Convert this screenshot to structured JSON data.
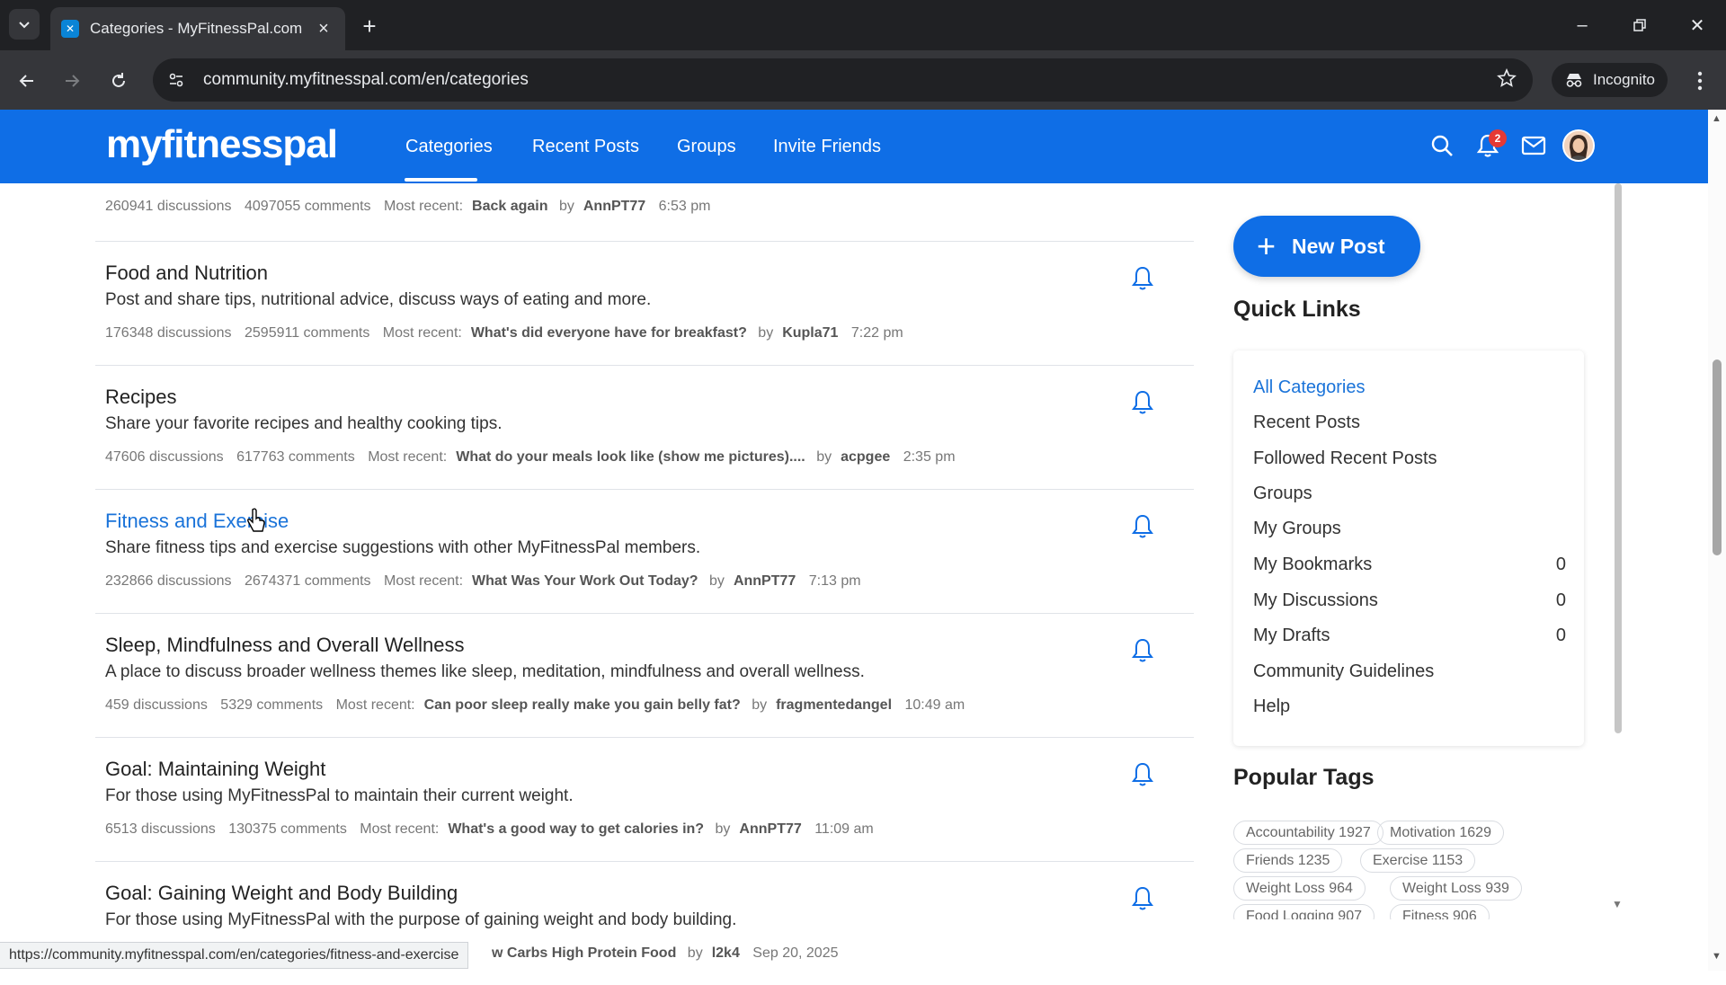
{
  "browser": {
    "tab_title": "Categories - MyFitnessPal.com",
    "url": "community.myfitnesspal.com/en/categories",
    "incognito_label": "Incognito"
  },
  "header": {
    "logo": "myfitnesspal",
    "nav": [
      "Categories",
      "Recent Posts",
      "Groups",
      "Invite Friends"
    ],
    "notification_count": "2",
    "brand_color": "#0f6ee6"
  },
  "first_meta": {
    "discussions": "260941 discussions",
    "comments": "4097055 comments",
    "recent_label": "Most recent:",
    "recent_title": "Back again",
    "by": "by",
    "author": "AnnPT77",
    "time": "6:53 pm"
  },
  "categories": [
    {
      "title": "Food and Nutrition",
      "desc": "Post and share tips, nutritional advice, discuss ways of eating and more.",
      "discussions": "176348 discussions",
      "comments": "2595911 comments",
      "recent_label": "Most recent:",
      "recent_title": "What's did everyone have for breakfast?",
      "by": "by",
      "author": "Kupla71",
      "time": "7:22 pm"
    },
    {
      "title": "Recipes",
      "desc": "Share your favorite recipes and healthy cooking tips.",
      "discussions": "47606 discussions",
      "comments": "617763 comments",
      "recent_label": "Most recent:",
      "recent_title": "What do your meals look like (show me pictures)....",
      "by": "by",
      "author": "acpgee",
      "time": "2:35 pm"
    },
    {
      "title": "Fitness and Exercise",
      "desc": "Share fitness tips and exercise suggestions with other MyFitnessPal members.",
      "discussions": "232866 discussions",
      "comments": "2674371 comments",
      "recent_label": "Most recent:",
      "recent_title": "What Was Your Work Out Today?",
      "by": "by",
      "author": "AnnPT77",
      "time": "7:13 pm"
    },
    {
      "title": "Sleep, Mindfulness and Overall Wellness",
      "desc": "A place to discuss broader wellness themes like sleep, meditation, mindfulness and overall wellness.",
      "discussions": "459 discussions",
      "comments": "5329 comments",
      "recent_label": "Most recent:",
      "recent_title": "Can poor sleep really make you gain belly fat?",
      "by": "by",
      "author": "fragmentedangel",
      "time": "10:49 am"
    },
    {
      "title": "Goal: Maintaining Weight",
      "desc": "For those using MyFitnessPal to maintain their current weight.",
      "discussions": "6513 discussions",
      "comments": "130375 comments",
      "recent_label": "Most recent:",
      "recent_title": "What's a good way to get calories in?",
      "by": "by",
      "author": "AnnPT77",
      "time": "11:09 am"
    },
    {
      "title": "Goal: Gaining Weight and Body Building",
      "desc": "For those using MyFitnessPal with the purpose of gaining weight and body building.",
      "recent_title_tail": "w Carbs High Protein Food",
      "by": "by",
      "author": "l2k4",
      "time": "Sep 20, 2025"
    }
  ],
  "sidebar": {
    "new_post": "New Post",
    "quick_links_heading": "Quick Links",
    "quick_links": [
      {
        "label": "All Categories",
        "count": ""
      },
      {
        "label": "Recent Posts",
        "count": ""
      },
      {
        "label": "Followed Recent Posts",
        "count": ""
      },
      {
        "label": "Groups",
        "count": ""
      },
      {
        "label": "My Groups",
        "count": ""
      },
      {
        "label": "My Bookmarks",
        "count": "0"
      },
      {
        "label": "My Discussions",
        "count": "0"
      },
      {
        "label": "My Drafts",
        "count": "0"
      },
      {
        "label": "Community Guidelines",
        "count": ""
      },
      {
        "label": "Help",
        "count": ""
      }
    ],
    "popular_tags_heading": "Popular Tags",
    "tags": [
      "Accountability 1927",
      "Motivation 1629",
      "Friends 1235",
      "Exercise 1153",
      "Weight Loss 964",
      "Weight Loss 939",
      "Food Logging 907",
      "Fitness 906"
    ]
  },
  "status_bar_url": "https://community.myfitnesspal.com/en/categories/fitness-and-exercise"
}
